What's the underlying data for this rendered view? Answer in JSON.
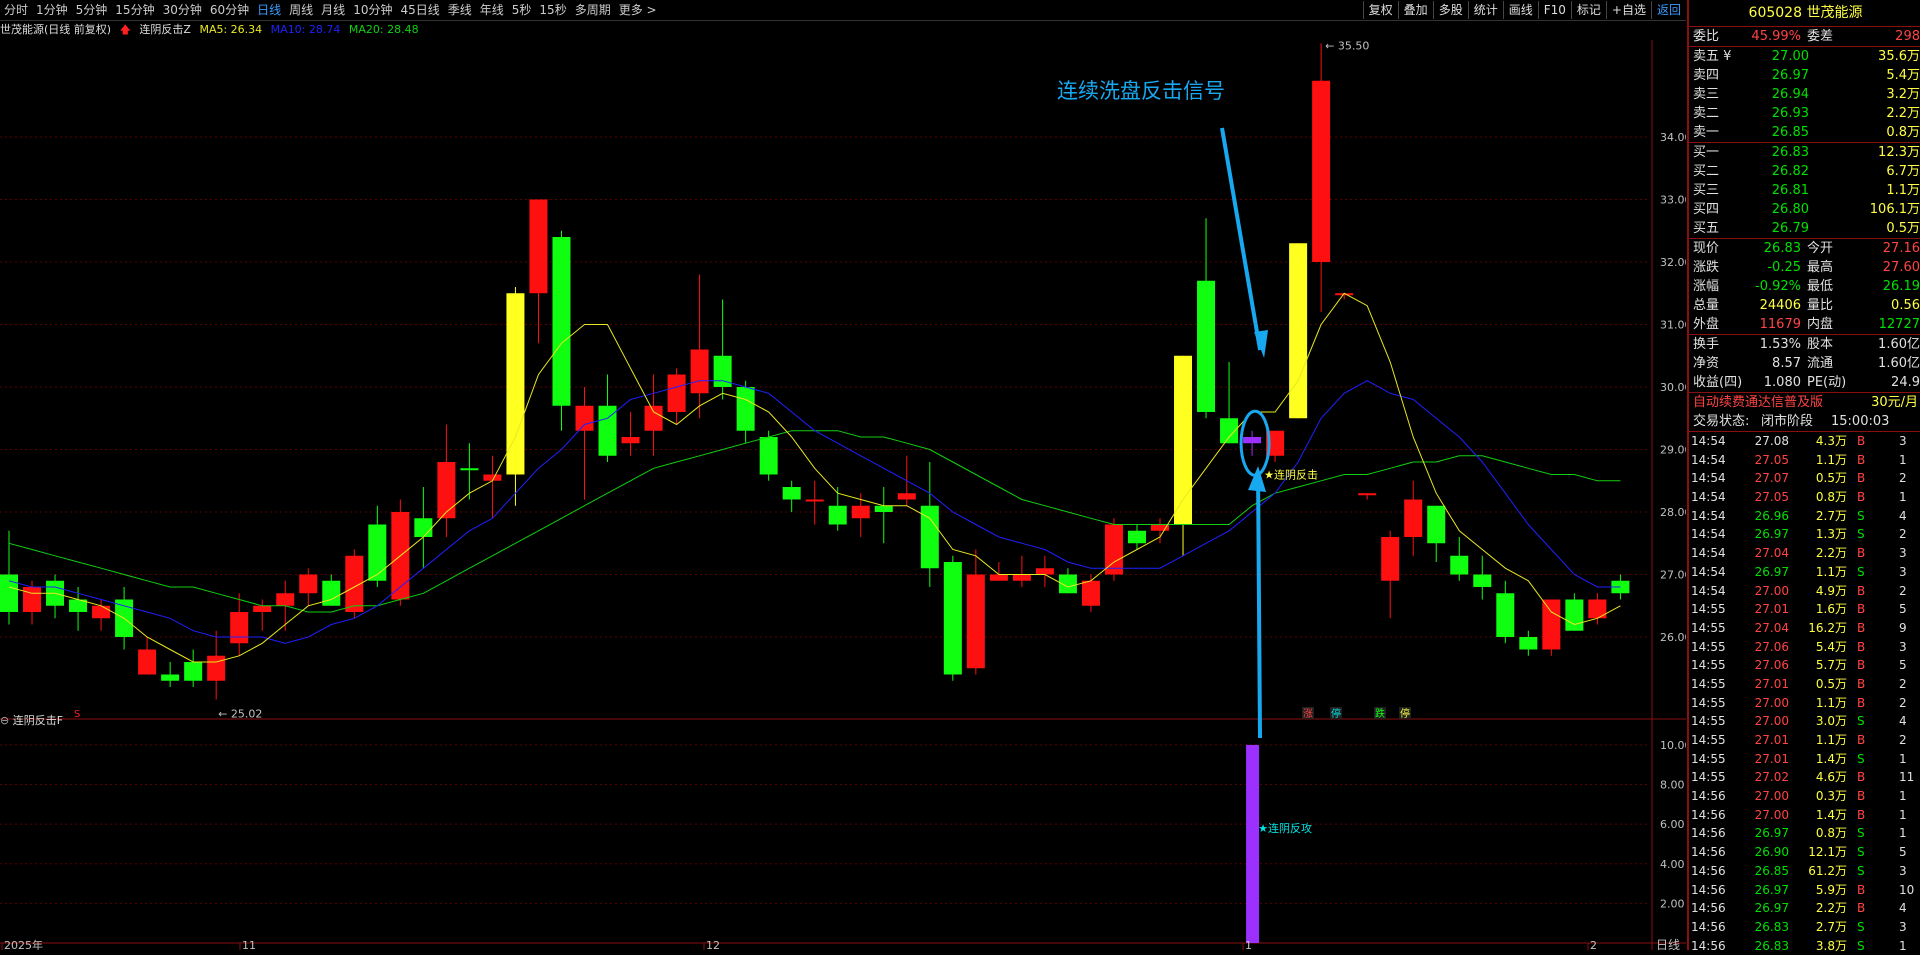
{
  "toolbar": {
    "periods": [
      "分时",
      "1分钟",
      "5分钟",
      "15分钟",
      "30分钟",
      "60分钟",
      "日线",
      "周线",
      "月线",
      "10分钟",
      "45日线",
      "季线",
      "年线",
      "5秒",
      "15秒",
      "多周期",
      "更多 >"
    ],
    "active_period": "日线",
    "right_buttons": [
      "复权",
      "叠加",
      "多股",
      "统计",
      "画线",
      "F10",
      "标记",
      "+自选",
      "返回"
    ]
  },
  "legend": {
    "title": "世茂能源(日线 前复权)",
    "indicator": "连阴反击Z",
    "ma5": "MA5: 26.34",
    "ma10": "MA10: 28.74",
    "ma20": "MA20: 28.48"
  },
  "colors": {
    "up": "#ff1010",
    "down": "#10ff10",
    "yellow": "#ffff20",
    "purple": "#9b30ff",
    "ma5": "#e8e820",
    "ma10": "#2020ff",
    "ma20": "#10d010",
    "grid": "#5a0000",
    "annot": "#18a8f0"
  },
  "chart": {
    "price_ticks": [
      "34.00",
      "33.00",
      "32.00",
      "31.00",
      "30.00",
      "29.00",
      "28.00",
      "27.00",
      "26.00"
    ],
    "max_label": "35.50",
    "min_label": "25.02",
    "annotation_text": "连续洗盘反击信号",
    "signal_label": "★连阴反击",
    "zt_tags": [
      "涨",
      "停",
      "跌",
      "停"
    ],
    "s_marker": "S",
    "x_labels": [
      "2025年",
      "11",
      "12",
      "1",
      "2"
    ],
    "period_label": "日线"
  },
  "indicator": {
    "title": "连阴反击F",
    "ticks": [
      "10.00",
      "8.00",
      "6.00",
      "4.00",
      "2.00"
    ],
    "bar_value": 10,
    "label": "★连阴反攻"
  },
  "panel": {
    "code": "605028",
    "name": "世茂能源",
    "weibi_label": "委比",
    "weibi_val": "45.99%",
    "weicha_label": "委差",
    "weicha_val": "298",
    "asks": [
      {
        "label": "卖五 ¥",
        "price": "27.00",
        "vol": "35.6万"
      },
      {
        "label": "卖四",
        "price": "26.97",
        "vol": "5.4万"
      },
      {
        "label": "卖三",
        "price": "26.94",
        "vol": "3.2万"
      },
      {
        "label": "卖二",
        "price": "26.93",
        "vol": "2.2万"
      },
      {
        "label": "卖一",
        "price": "26.85",
        "vol": "0.8万"
      }
    ],
    "bids": [
      {
        "label": "买一",
        "price": "26.83",
        "vol": "12.3万"
      },
      {
        "label": "买二",
        "price": "26.82",
        "vol": "6.7万"
      },
      {
        "label": "买三",
        "price": "26.81",
        "vol": "1.1万"
      },
      {
        "label": "买四",
        "price": "26.80",
        "vol": "106.1万"
      },
      {
        "label": "买五",
        "price": "26.79",
        "vol": "0.5万"
      }
    ],
    "quote": [
      {
        "l1": "现价",
        "v1": "26.83",
        "c1": "green",
        "l2": "今开",
        "v2": "27.16",
        "c2": "red"
      },
      {
        "l1": "涨跌",
        "v1": "-0.25",
        "c1": "green",
        "l2": "最高",
        "v2": "27.60",
        "c2": "red"
      },
      {
        "l1": "涨幅",
        "v1": "-0.92%",
        "c1": "green",
        "l2": "最低",
        "v2": "26.19",
        "c2": "green"
      },
      {
        "l1": "总量",
        "v1": "24406",
        "c1": "yellow",
        "l2": "量比",
        "v2": "0.56",
        "c2": "yellow"
      },
      {
        "l1": "外盘",
        "v1": "11679",
        "c1": "red",
        "l2": "内盘",
        "v2": "12727",
        "c2": "green"
      }
    ],
    "fund": [
      {
        "l1": "换手",
        "v1": "1.53%",
        "l2": "股本",
        "v2": "1.60亿"
      },
      {
        "l1": "净资",
        "v1": "8.57",
        "l2": "流通",
        "v2": "1.60亿"
      },
      {
        "l1": "收益(四)",
        "v1": "1.080",
        "l2": "PE(动)",
        "v2": "24.9"
      }
    ],
    "ad_text": "自动续费通达信普及版",
    "ad_price": "30元/月",
    "status_label": "交易状态:",
    "status_val": "闭市阶段",
    "status_time": "15:00:03",
    "ticks": [
      {
        "t": "14:54",
        "p": "27.08",
        "v": "4.3万",
        "d": "B",
        "n": "3"
      },
      {
        "t": "14:54",
        "p": "27.05",
        "v": "1.1万",
        "d": "B",
        "n": "1"
      },
      {
        "t": "14:54",
        "p": "27.07",
        "v": "0.5万",
        "d": "B",
        "n": "2"
      },
      {
        "t": "14:54",
        "p": "27.05",
        "v": "0.8万",
        "d": "B",
        "n": "1"
      },
      {
        "t": "14:54",
        "p": "26.96",
        "v": "2.7万",
        "d": "S",
        "n": "4"
      },
      {
        "t": "14:54",
        "p": "26.97",
        "v": "1.3万",
        "d": "S",
        "n": "2"
      },
      {
        "t": "14:54",
        "p": "27.04",
        "v": "2.2万",
        "d": "B",
        "n": "3"
      },
      {
        "t": "14:54",
        "p": "26.97",
        "v": "1.1万",
        "d": "S",
        "n": "3"
      },
      {
        "t": "14:54",
        "p": "27.00",
        "v": "4.9万",
        "d": "B",
        "n": "2"
      },
      {
        "t": "14:55",
        "p": "27.01",
        "v": "1.6万",
        "d": "B",
        "n": "5"
      },
      {
        "t": "14:55",
        "p": "27.04",
        "v": "16.2万",
        "d": "B",
        "n": "9"
      },
      {
        "t": "14:55",
        "p": "27.06",
        "v": "5.4万",
        "d": "B",
        "n": "3"
      },
      {
        "t": "14:55",
        "p": "27.06",
        "v": "5.7万",
        "d": "B",
        "n": "5"
      },
      {
        "t": "14:55",
        "p": "27.01",
        "v": "0.5万",
        "d": "B",
        "n": "2"
      },
      {
        "t": "14:55",
        "p": "27.00",
        "v": "1.1万",
        "d": "B",
        "n": "2"
      },
      {
        "t": "14:55",
        "p": "27.00",
        "v": "3.0万",
        "d": "S",
        "n": "4"
      },
      {
        "t": "14:55",
        "p": "27.01",
        "v": "1.1万",
        "d": "B",
        "n": "2"
      },
      {
        "t": "14:55",
        "p": "27.01",
        "v": "1.4万",
        "d": "S",
        "n": "1"
      },
      {
        "t": "14:55",
        "p": "27.02",
        "v": "4.6万",
        "d": "B",
        "n": "11"
      },
      {
        "t": "14:56",
        "p": "27.00",
        "v": "0.3万",
        "d": "B",
        "n": "1"
      },
      {
        "t": "14:56",
        "p": "27.00",
        "v": "1.4万",
        "d": "B",
        "n": "1"
      },
      {
        "t": "14:56",
        "p": "26.97",
        "v": "0.8万",
        "d": "S",
        "n": "1"
      },
      {
        "t": "14:56",
        "p": "26.90",
        "v": "12.1万",
        "d": "S",
        "n": "5"
      },
      {
        "t": "14:56",
        "p": "26.85",
        "v": "61.2万",
        "d": "S",
        "n": "3"
      },
      {
        "t": "14:56",
        "p": "26.97",
        "v": "5.9万",
        "d": "B",
        "n": "10"
      },
      {
        "t": "14:56",
        "p": "26.97",
        "v": "2.2万",
        "d": "B",
        "n": "4"
      },
      {
        "t": "14:56",
        "p": "26.83",
        "v": "2.7万",
        "d": "S",
        "n": "3"
      },
      {
        "t": "14:56",
        "p": "26.83",
        "v": "3.8万",
        "d": "S",
        "n": "1"
      }
    ]
  },
  "chart_data": {
    "type": "candlestick",
    "ylim": [
      24.9,
      35.7
    ],
    "candles": [
      {
        "o": 27.0,
        "h": 27.7,
        "l": 26.2,
        "c": 26.4,
        "k": "down"
      },
      {
        "o": 26.4,
        "h": 26.9,
        "l": 26.2,
        "c": 26.8,
        "k": "up"
      },
      {
        "o": 26.9,
        "h": 27.0,
        "l": 26.3,
        "c": 26.5,
        "k": "down"
      },
      {
        "o": 26.6,
        "h": 26.8,
        "l": 26.1,
        "c": 26.4,
        "k": "down"
      },
      {
        "o": 26.3,
        "h": 26.6,
        "l": 26.1,
        "c": 26.5,
        "k": "up"
      },
      {
        "o": 26.6,
        "h": 26.8,
        "l": 25.8,
        "c": 26.0,
        "k": "down"
      },
      {
        "o": 25.8,
        "h": 26.0,
        "l": 25.4,
        "c": 25.4,
        "k": "up"
      },
      {
        "o": 25.4,
        "h": 25.6,
        "l": 25.2,
        "c": 25.3,
        "k": "down"
      },
      {
        "o": 25.6,
        "h": 25.8,
        "l": 25.2,
        "c": 25.3,
        "k": "down"
      },
      {
        "o": 25.3,
        "h": 26.1,
        "l": 25.0,
        "c": 25.7,
        "k": "up"
      },
      {
        "o": 25.9,
        "h": 26.7,
        "l": 25.7,
        "c": 26.4,
        "k": "up"
      },
      {
        "o": 26.4,
        "h": 26.6,
        "l": 26.1,
        "c": 26.5,
        "k": "up"
      },
      {
        "o": 26.5,
        "h": 26.9,
        "l": 26.1,
        "c": 26.7,
        "k": "up"
      },
      {
        "o": 26.7,
        "h": 27.1,
        "l": 26.5,
        "c": 27.0,
        "k": "up"
      },
      {
        "o": 26.9,
        "h": 27.0,
        "l": 26.5,
        "c": 26.5,
        "k": "down"
      },
      {
        "o": 26.4,
        "h": 27.4,
        "l": 26.3,
        "c": 27.3,
        "k": "up"
      },
      {
        "o": 26.9,
        "h": 28.1,
        "l": 26.8,
        "c": 27.8,
        "k": "down"
      },
      {
        "o": 26.6,
        "h": 28.2,
        "l": 26.5,
        "c": 28.0,
        "k": "up"
      },
      {
        "o": 27.6,
        "h": 28.4,
        "l": 27.1,
        "c": 27.9,
        "k": "down"
      },
      {
        "o": 27.9,
        "h": 29.4,
        "l": 27.6,
        "c": 28.8,
        "k": "up"
      },
      {
        "o": 28.7,
        "h": 29.1,
        "l": 28.2,
        "c": 28.7,
        "k": "down"
      },
      {
        "o": 28.5,
        "h": 28.9,
        "l": 27.9,
        "c": 28.6,
        "k": "up"
      },
      {
        "o": 28.6,
        "h": 31.6,
        "l": 28.1,
        "c": 31.5,
        "k": "yellow"
      },
      {
        "o": 31.5,
        "h": 33.0,
        "l": 30.7,
        "c": 33.0,
        "k": "up"
      },
      {
        "o": 32.4,
        "h": 32.5,
        "l": 29.3,
        "c": 29.7,
        "k": "down"
      },
      {
        "o": 29.3,
        "h": 30.0,
        "l": 28.2,
        "c": 29.7,
        "k": "up"
      },
      {
        "o": 29.7,
        "h": 30.2,
        "l": 28.8,
        "c": 28.9,
        "k": "down"
      },
      {
        "o": 29.1,
        "h": 29.6,
        "l": 28.9,
        "c": 29.2,
        "k": "up"
      },
      {
        "o": 29.3,
        "h": 30.2,
        "l": 28.9,
        "c": 29.7,
        "k": "up"
      },
      {
        "o": 29.6,
        "h": 30.3,
        "l": 29.4,
        "c": 30.2,
        "k": "up"
      },
      {
        "o": 29.9,
        "h": 31.8,
        "l": 29.5,
        "c": 30.6,
        "k": "up"
      },
      {
        "o": 30.5,
        "h": 31.4,
        "l": 29.8,
        "c": 30.0,
        "k": "down"
      },
      {
        "o": 30.0,
        "h": 30.1,
        "l": 29.1,
        "c": 29.3,
        "k": "down"
      },
      {
        "o": 29.2,
        "h": 29.3,
        "l": 28.5,
        "c": 28.6,
        "k": "down"
      },
      {
        "o": 28.4,
        "h": 28.5,
        "l": 28.0,
        "c": 28.2,
        "k": "down"
      },
      {
        "o": 28.2,
        "h": 28.5,
        "l": 27.8,
        "c": 28.2,
        "k": "up"
      },
      {
        "o": 28.1,
        "h": 28.4,
        "l": 27.7,
        "c": 27.8,
        "k": "down"
      },
      {
        "o": 27.9,
        "h": 28.3,
        "l": 27.6,
        "c": 28.1,
        "k": "up"
      },
      {
        "o": 28.1,
        "h": 28.4,
        "l": 27.5,
        "c": 28.0,
        "k": "down"
      },
      {
        "o": 28.2,
        "h": 28.9,
        "l": 28.1,
        "c": 28.3,
        "k": "up"
      },
      {
        "o": 28.1,
        "h": 28.8,
        "l": 26.8,
        "c": 27.1,
        "k": "down"
      },
      {
        "o": 27.2,
        "h": 27.3,
        "l": 25.3,
        "c": 25.4,
        "k": "down"
      },
      {
        "o": 25.5,
        "h": 27.4,
        "l": 25.4,
        "c": 27.0,
        "k": "up"
      },
      {
        "o": 26.9,
        "h": 27.2,
        "l": 26.9,
        "c": 27.0,
        "k": "up"
      },
      {
        "o": 26.9,
        "h": 27.3,
        "l": 26.8,
        "c": 27.0,
        "k": "up"
      },
      {
        "o": 27.0,
        "h": 27.3,
        "l": 26.8,
        "c": 27.1,
        "k": "up"
      },
      {
        "o": 27.0,
        "h": 27.1,
        "l": 26.7,
        "c": 26.7,
        "k": "down"
      },
      {
        "o": 26.5,
        "h": 27.0,
        "l": 26.4,
        "c": 26.9,
        "k": "up"
      },
      {
        "o": 27.0,
        "h": 27.9,
        "l": 26.9,
        "c": 27.8,
        "k": "up"
      },
      {
        "o": 27.7,
        "h": 27.8,
        "l": 27.4,
        "c": 27.5,
        "k": "down"
      },
      {
        "o": 27.7,
        "h": 27.9,
        "l": 27.5,
        "c": 27.8,
        "k": "up"
      },
      {
        "o": 27.8,
        "h": 30.5,
        "l": 27.3,
        "c": 30.5,
        "k": "yellow"
      },
      {
        "o": 31.7,
        "h": 32.7,
        "l": 29.5,
        "c": 29.6,
        "k": "down"
      },
      {
        "o": 29.5,
        "h": 30.4,
        "l": 29.1,
        "c": 29.1,
        "k": "down"
      },
      {
        "o": 29.1,
        "h": 29.3,
        "l": 28.9,
        "c": 29.2,
        "k": "purple"
      },
      {
        "o": 28.9,
        "h": 29.3,
        "l": 28.8,
        "c": 29.3,
        "k": "up"
      },
      {
        "o": 29.5,
        "h": 32.3,
        "l": 29.5,
        "c": 32.3,
        "k": "yellow"
      },
      {
        "o": 32.0,
        "h": 35.5,
        "l": 31.2,
        "c": 34.9,
        "k": "up"
      },
      {
        "o": 31.5,
        "h": 31.5,
        "l": 31.4,
        "c": 31.5,
        "k": "up"
      },
      {
        "o": 28.3,
        "h": 28.3,
        "l": 28.2,
        "c": 28.3,
        "k": "up"
      },
      {
        "o": 26.9,
        "h": 27.7,
        "l": 26.3,
        "c": 27.6,
        "k": "up"
      },
      {
        "o": 27.6,
        "h": 28.5,
        "l": 27.3,
        "c": 28.2,
        "k": "up"
      },
      {
        "o": 28.1,
        "h": 28.1,
        "l": 27.2,
        "c": 27.5,
        "k": "down"
      },
      {
        "o": 27.3,
        "h": 27.6,
        "l": 26.9,
        "c": 27.0,
        "k": "down"
      },
      {
        "o": 27.0,
        "h": 27.3,
        "l": 26.6,
        "c": 26.8,
        "k": "down"
      },
      {
        "o": 26.7,
        "h": 26.9,
        "l": 25.9,
        "c": 26.0,
        "k": "down"
      },
      {
        "o": 26.0,
        "h": 26.1,
        "l": 25.7,
        "c": 25.8,
        "k": "down"
      },
      {
        "o": 25.8,
        "h": 26.6,
        "l": 25.7,
        "c": 26.6,
        "k": "up"
      },
      {
        "o": 26.6,
        "h": 26.7,
        "l": 26.1,
        "c": 26.1,
        "k": "down"
      },
      {
        "o": 26.3,
        "h": 26.7,
        "l": 26.2,
        "c": 26.6,
        "k": "up"
      },
      {
        "o": 26.7,
        "h": 27.0,
        "l": 26.6,
        "c": 26.9,
        "k": "down"
      }
    ],
    "ma5": [
      26.8,
      26.7,
      26.7,
      26.6,
      26.5,
      26.3,
      26.0,
      25.8,
      25.6,
      25.6,
      25.7,
      25.9,
      26.2,
      26.5,
      26.6,
      26.8,
      27.0,
      27.3,
      27.6,
      28.0,
      28.3,
      28.5,
      29.2,
      30.2,
      30.7,
      31.0,
      31.0,
      30.3,
      29.6,
      29.4,
      29.7,
      29.9,
      29.8,
      29.6,
      29.2,
      28.7,
      28.3,
      28.2,
      28.1,
      28.1,
      27.9,
      27.4,
      27.3,
      27.0,
      27.0,
      27.0,
      26.8,
      26.9,
      27.2,
      27.4,
      27.6,
      28.2,
      28.7,
      29.2,
      29.6,
      29.6,
      30.1,
      31.0,
      31.5,
      31.3,
      30.4,
      29.2,
      28.3,
      27.7,
      27.4,
      27.1,
      26.9,
      26.4,
      26.2,
      26.3,
      26.5
    ],
    "ma10": [
      26.9,
      26.8,
      26.8,
      26.7,
      26.6,
      26.5,
      26.4,
      26.3,
      26.1,
      26.0,
      26.0,
      26.0,
      25.9,
      26.0,
      26.2,
      26.3,
      26.5,
      26.8,
      27.1,
      27.4,
      27.7,
      27.9,
      28.3,
      28.7,
      29.0,
      29.4,
      29.5,
      29.8,
      29.9,
      30.0,
      30.1,
      30.1,
      30.0,
      29.9,
      29.6,
      29.3,
      29.1,
      28.9,
      28.7,
      28.5,
      28.3,
      28.0,
      27.8,
      27.6,
      27.5,
      27.4,
      27.2,
      27.1,
      27.1,
      27.1,
      27.1,
      27.3,
      27.5,
      27.7,
      28.0,
      28.3,
      28.8,
      29.5,
      29.9,
      30.1,
      29.9,
      29.8,
      29.5,
      29.2,
      28.8,
      28.3,
      27.8,
      27.4,
      27.0,
      26.8,
      26.8
    ],
    "ma20": [
      27.5,
      27.4,
      27.3,
      27.2,
      27.1,
      27.0,
      26.9,
      26.8,
      26.8,
      26.7,
      26.6,
      26.5,
      26.5,
      26.4,
      26.4,
      26.5,
      26.5,
      26.6,
      26.7,
      26.9,
      27.1,
      27.3,
      27.5,
      27.7,
      27.9,
      28.1,
      28.3,
      28.5,
      28.7,
      28.8,
      28.9,
      29.0,
      29.1,
      29.2,
      29.3,
      29.3,
      29.3,
      29.2,
      29.2,
      29.1,
      29.0,
      28.8,
      28.6,
      28.4,
      28.2,
      28.1,
      28.0,
      27.9,
      27.8,
      27.8,
      27.8,
      27.8,
      27.8,
      27.8,
      28.1,
      28.3,
      28.4,
      28.5,
      28.6,
      28.6,
      28.7,
      28.8,
      28.8,
      28.9,
      28.9,
      28.8,
      28.7,
      28.6,
      28.6,
      28.5,
      28.5
    ]
  }
}
